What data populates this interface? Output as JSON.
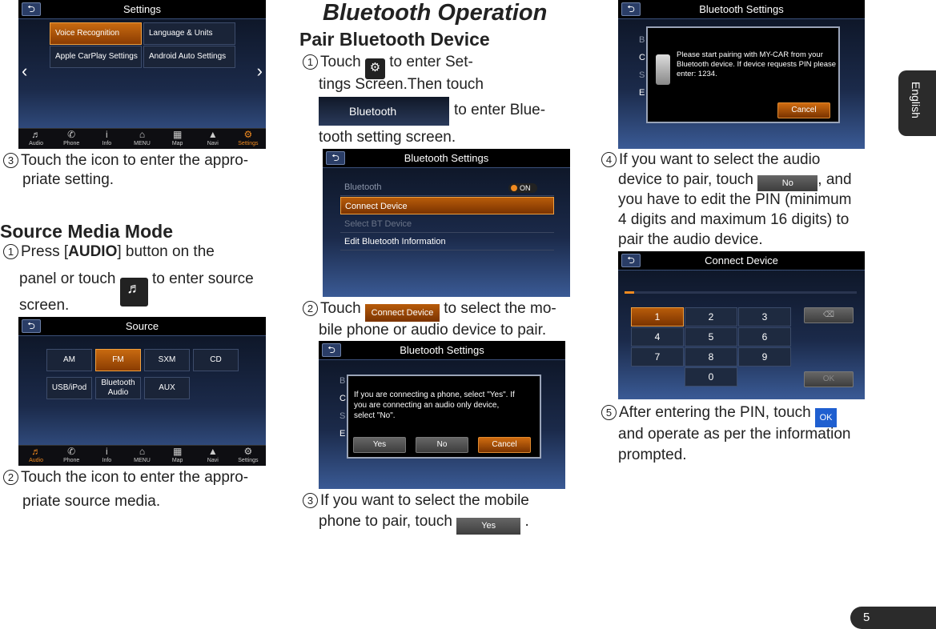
{
  "settings_screen": {
    "title": "Settings",
    "tiles": [
      "Voice Recognition",
      "Language & Units",
      "Apple CarPlay Settings",
      "Android Auto Settings"
    ],
    "dock": [
      "Audio",
      "Phone",
      "Info",
      "MENU",
      "Map",
      "Navi",
      "Settings"
    ]
  },
  "left": {
    "step3": {
      "num": "3",
      "line1": "Touch the icon to enter the appro-",
      "line2": "priate setting."
    },
    "section_title": "Source Media Mode",
    "step1": {
      "num": "1",
      "pre": "Press [",
      "bold": "AUDIO",
      "post": "] button on the",
      "line2a": "panel  or touch",
      "line2b": "to enter source",
      "line3": "screen.",
      "icon_label": "Audio"
    },
    "step2": {
      "num": "2",
      "line1": "Touch the icon to enter the appro-",
      "line2": "priate source media."
    }
  },
  "source_screen": {
    "title": "Source",
    "tiles": [
      "AM",
      "FM",
      "SXM",
      "CD",
      "USB/iPod",
      "Bluetooth Audio",
      "AUX"
    ],
    "dock": [
      "Audio",
      "Phone",
      "Info",
      "MENU",
      "Map",
      "Navi",
      "Settings"
    ]
  },
  "middle": {
    "title": "Bluetooth Operation",
    "subtitle": "Pair Bluetooth Device",
    "step1": {
      "num": "1",
      "pre": "Touch",
      "post": "to enter Set-",
      "line2": "tings Screen.Then touch",
      "btn": "Bluetooth",
      "post2": "to enter Blue-",
      "line4": "tooth setting screen.",
      "icon_label": "Settings"
    },
    "step2": {
      "num": "2",
      "pre": "Touch",
      "btn": "Connect Device",
      "post": "to select the mo-",
      "line2": "bile phone or audio device to pair."
    },
    "step3": {
      "num": "3",
      "line1": "If you want to select the mobile",
      "pre": "phone  to pair, touch",
      "btn": "Yes",
      "post": "."
    }
  },
  "bt_screen": {
    "title": "Bluetooth Settings",
    "rows": [
      "Bluetooth",
      "Connect Device",
      "Select BT Device",
      "Edit Bluetooth Information"
    ],
    "toggle": "ON"
  },
  "dialog_screen": {
    "title": "Bluetooth Settings",
    "message": "If you are connecting a phone, select \"Yes\".  If you are connecting an audio only device, select \"No\".",
    "buttons": [
      "Yes",
      "No",
      "Cancel"
    ],
    "bg_letters": [
      "B",
      "C",
      "S",
      "E"
    ]
  },
  "pair_screen": {
    "title": "Bluetooth Settings",
    "message": "Please start pairing with MY-CAR from your Bluetooth device.  If device requests PIN please enter: 1234.",
    "button": "Cancel",
    "bg_letters": [
      "B",
      "C",
      "S",
      "E"
    ]
  },
  "right": {
    "step4": {
      "num": "4",
      "pre": "If you want to select the audio",
      "l2pre": "device to pair, touch",
      "btn": "No",
      "l2post": ", and",
      "line3": "you have to edit the PIN (minimum",
      "line4": "4 digits and maximum 16 digits) to",
      "line5": "pair the audio device."
    },
    "step5": {
      "num": "5",
      "pre": "After entering the PIN, touch",
      "btn": "OK",
      "line2": "and operate as per the information",
      "line3": "prompted."
    }
  },
  "keypad_screen": {
    "title": "Connect Device",
    "keys": [
      "1",
      "2",
      "3",
      "4",
      "5",
      "6",
      "7",
      "8",
      "9",
      "0"
    ],
    "ok": "OK"
  },
  "side_tab": "English",
  "page_number": "5"
}
